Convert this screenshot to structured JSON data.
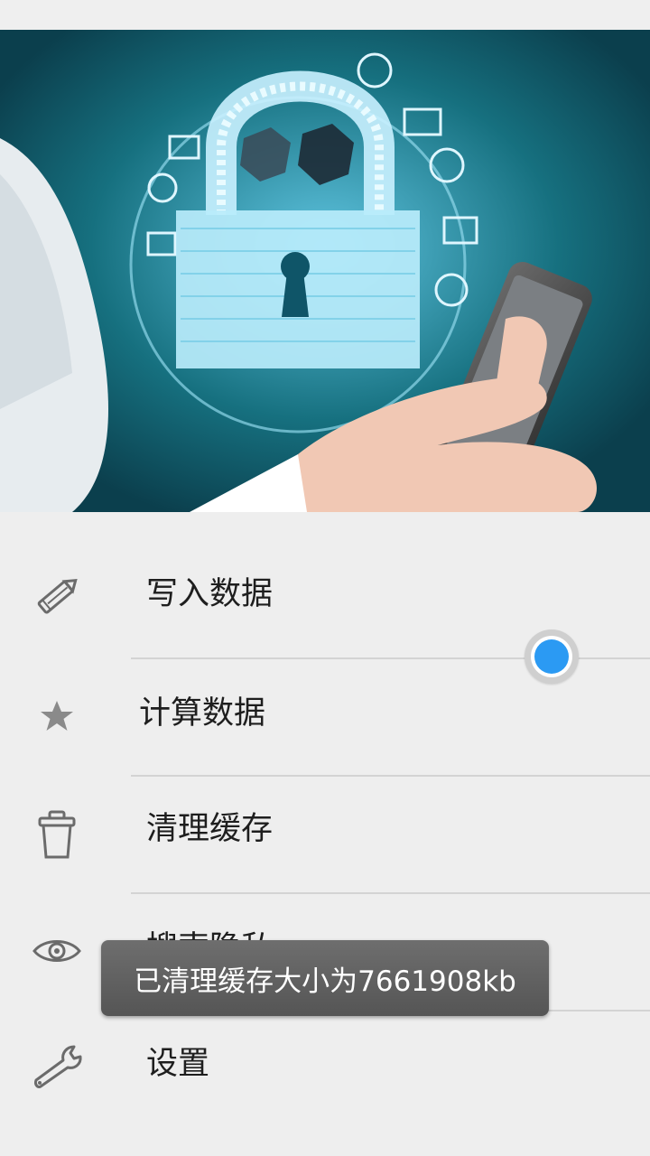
{
  "menu": {
    "items": [
      {
        "label": "写入数据",
        "icon": "pencil-icon"
      },
      {
        "label": "计算数据",
        "icon": "star-icon"
      },
      {
        "label": "清理缓存",
        "icon": "trash-icon"
      },
      {
        "label": "搜索隐私",
        "icon": "eye-icon"
      },
      {
        "label": "设置",
        "icon": "wrench-icon"
      }
    ]
  },
  "toast": {
    "message": "已清理缓存大小为7661908kb"
  },
  "colors": {
    "accent": "#2b9af3",
    "hero_background": "#0f5568"
  }
}
